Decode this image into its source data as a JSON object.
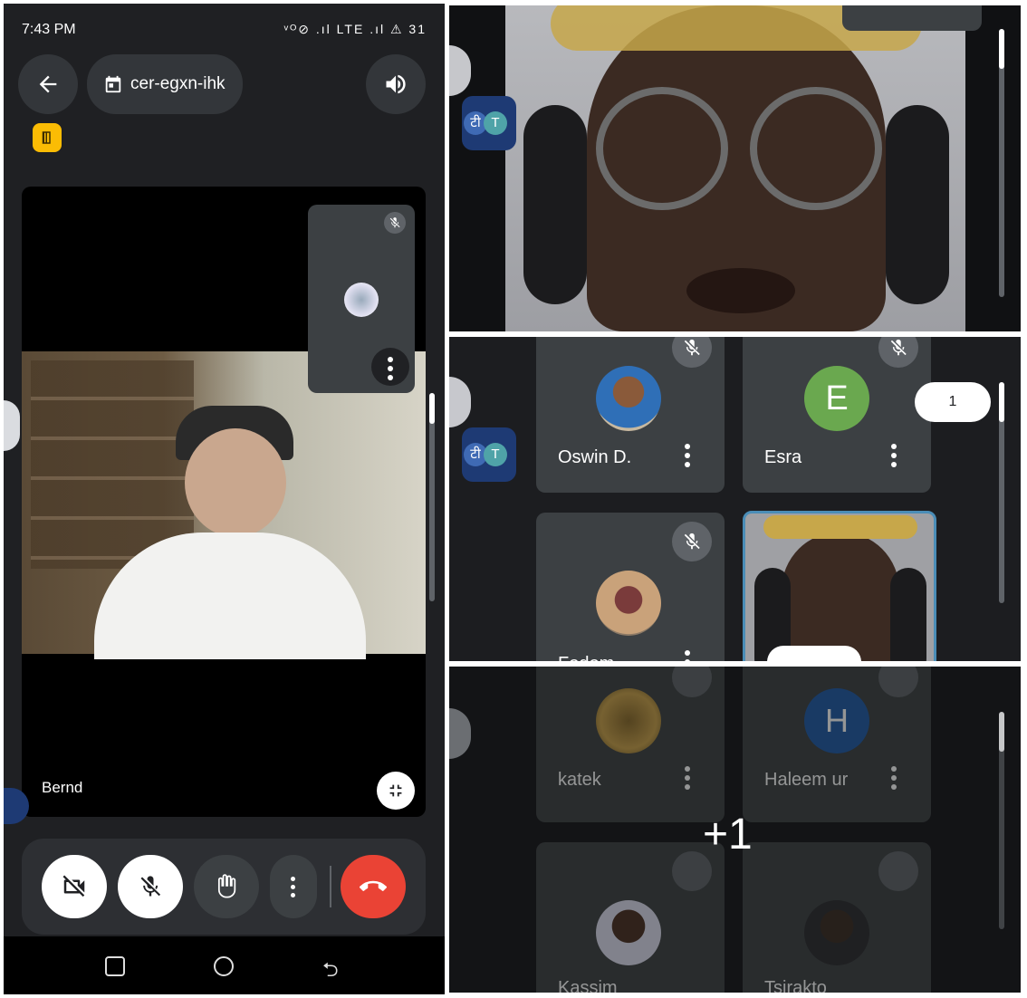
{
  "status_bar": {
    "time": "7:43 PM",
    "icons": "ᵛᴼ⊘ .ıl LTE .ıl ⚠ 31"
  },
  "header": {
    "meeting_code": "cer-egxn-ihk"
  },
  "main_video": {
    "participant_name": "Bernd"
  },
  "controls": {
    "buttons": [
      "camera-off",
      "mic-off",
      "raise-hand",
      "more-options",
      "end-call"
    ]
  },
  "grid_top": {
    "badge_count": "1",
    "translate_badge": [
      "टी",
      "T"
    ]
  },
  "grid_tiles": [
    {
      "name": "Oswin D.",
      "initial": "",
      "avatar_color": ""
    },
    {
      "name": "Esra",
      "initial": "E",
      "avatar_color": "#6aa84f"
    },
    {
      "name": "Fodom",
      "initial": "",
      "avatar_color": ""
    },
    {
      "name": "",
      "initial": "",
      "avatar_color": ""
    }
  ],
  "grid_bottom": {
    "overflow_label": "+1",
    "tiles": [
      {
        "name": "katek",
        "initial": "",
        "avatar_color": ""
      },
      {
        "name": "Haleem ur",
        "initial": "H",
        "avatar_color": "#1f5aa6"
      },
      {
        "name": "Kassim",
        "initial": "",
        "avatar_color": ""
      },
      {
        "name": "Tsirakto",
        "initial": "",
        "avatar_color": ""
      }
    ]
  },
  "colors": {
    "end_call": "#ea4335",
    "accent_badge": "#fbbc04",
    "active_border": "#4a8db7"
  }
}
